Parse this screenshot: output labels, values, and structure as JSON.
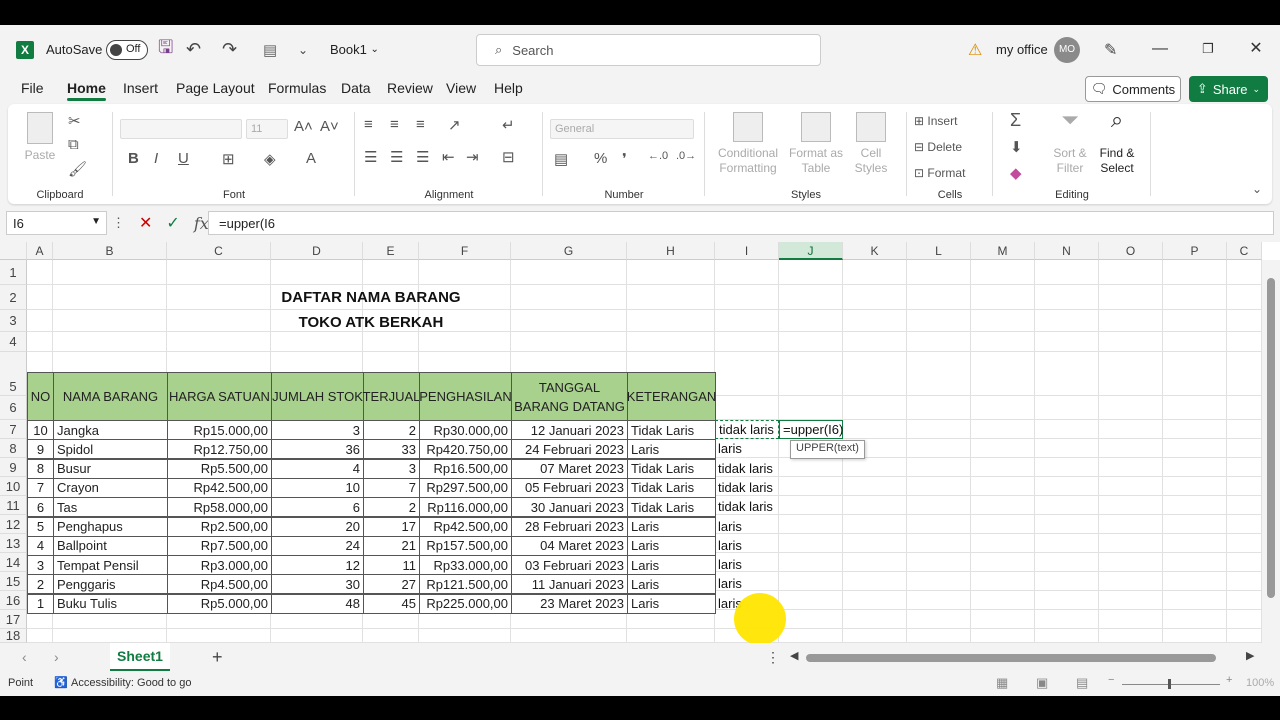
{
  "titlebar": {
    "autosave_label": "AutoSave",
    "autosave_state": "Off",
    "book_name": "Book1",
    "search_placeholder": "Search",
    "account_name": "my office",
    "avatar_initials": "MO"
  },
  "menu": {
    "items": [
      "File",
      "Home",
      "Insert",
      "Page Layout",
      "Formulas",
      "Data",
      "Review",
      "View",
      "Help"
    ],
    "active": "Home",
    "comments_label": "Comments",
    "share_label": "Share"
  },
  "ribbon": {
    "clipboard": {
      "paste": "Paste",
      "label": "Clipboard"
    },
    "font": {
      "size": "11",
      "label": "Font"
    },
    "alignment": {
      "label": "Alignment"
    },
    "number": {
      "format": "General",
      "label": "Number"
    },
    "styles": {
      "conditional": "Conditional Formatting",
      "format_table": "Format as Table",
      "cell_styles": "Cell Styles",
      "label": "Styles"
    },
    "cells": {
      "insert": "Insert",
      "delete": "Delete",
      "format": "Format",
      "label": "Cells"
    },
    "editing": {
      "sort": "Sort & Filter",
      "find": "Find & Select",
      "label": "Editing"
    }
  },
  "formula_bar": {
    "name_box": "I6",
    "formula": "=upper(I6"
  },
  "grid": {
    "columns": [
      "A",
      "B",
      "C",
      "D",
      "E",
      "F",
      "G",
      "H",
      "I",
      "J",
      "K",
      "L",
      "M",
      "N",
      "O",
      "P",
      "C"
    ],
    "rows": [
      "1",
      "2",
      "3",
      "4",
      "5",
      "6",
      "7",
      "8",
      "9",
      "10",
      "11",
      "12",
      "13",
      "14",
      "15",
      "16",
      "17",
      "18"
    ],
    "title1": "DAFTAR NAMA BARANG",
    "title2": "TOKO ATK BERKAH",
    "headers": [
      "NO",
      "NAMA BARANG",
      "HARGA SATUAN",
      "JUMLAH STOK",
      "TERJUAL",
      "PENGHASILAN",
      "TANGGAL BARANG DATANG",
      "KETERANGAN"
    ],
    "table": [
      [
        "10",
        "Jangka",
        "Rp15.000,00",
        "3",
        "2",
        "Rp30.000,00",
        "12 Januari 2023",
        "Tidak Laris"
      ],
      [
        "9",
        "Spidol",
        "Rp12.750,00",
        "36",
        "33",
        "Rp420.750,00",
        "24 Februari 2023",
        "Laris"
      ],
      [
        "8",
        "Busur",
        "Rp5.500,00",
        "4",
        "3",
        "Rp16.500,00",
        "07 Maret 2023",
        "Tidak Laris"
      ],
      [
        "7",
        "Crayon",
        "Rp42.500,00",
        "10",
        "7",
        "Rp297.500,00",
        "05 Februari 2023",
        "Tidak Laris"
      ],
      [
        "6",
        "Tas",
        "Rp58.000,00",
        "6",
        "2",
        "Rp116.000,00",
        "30 Januari 2023",
        "Tidak Laris"
      ],
      [
        "5",
        "Penghapus",
        "Rp2.500,00",
        "20",
        "17",
        "Rp42.500,00",
        "28 Februari 2023",
        "Laris"
      ],
      [
        "4",
        "Ballpoint",
        "Rp7.500,00",
        "24",
        "21",
        "Rp157.500,00",
        "04 Maret 2023",
        "Laris"
      ],
      [
        "3",
        "Tempat Pensil",
        "Rp3.000,00",
        "12",
        "11",
        "Rp33.000,00",
        "03 Februari 2023",
        "Laris"
      ],
      [
        "2",
        "Penggaris",
        "Rp4.500,00",
        "30",
        "27",
        "Rp121.500,00",
        "11 Januari 2023",
        "Laris"
      ],
      [
        "1",
        "Buku Tulis",
        "Rp5.000,00",
        "48",
        "45",
        "Rp225.000,00",
        "23 Maret 2023",
        "Laris"
      ]
    ],
    "col_i": [
      "tidak laris",
      "laris",
      "tidak laris",
      "tidak laris",
      "tidak laris",
      "laris",
      "laris",
      "laris",
      "laris",
      "laris"
    ],
    "j6_formula": "=upper(I6)",
    "tooltip": "UPPER(text)"
  },
  "sheets": {
    "active": "Sheet1"
  },
  "status": {
    "mode": "Point",
    "accessibility": "Accessibility: Good to go",
    "zoom": "100%"
  }
}
